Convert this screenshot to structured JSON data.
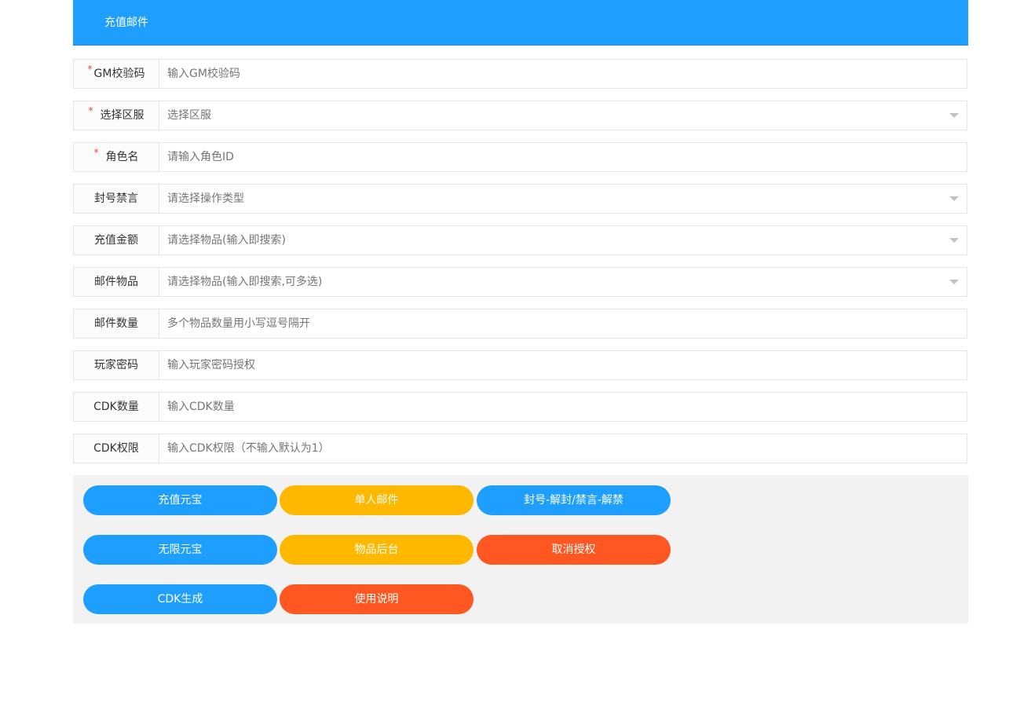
{
  "header": {
    "title": "充值邮件"
  },
  "form": {
    "gm_code": {
      "label": "GM校验码",
      "placeholder": "输入GM校验码"
    },
    "server": {
      "label": "选择区服",
      "placeholder": "选择区服"
    },
    "role_name": {
      "label": "角色名",
      "placeholder": "请输入角色ID"
    },
    "ban_mute": {
      "label": "封号禁言",
      "placeholder": "请选择操作类型"
    },
    "recharge_amount": {
      "label": "充值金额",
      "placeholder": "请选择物品(输入即搜索)"
    },
    "mail_items": {
      "label": "邮件物品",
      "placeholder": "请选择物品(输入即搜索,可多选)"
    },
    "mail_quantity": {
      "label": "邮件数量",
      "placeholder": "多个物品数量用小写逗号隔开"
    },
    "player_password": {
      "label": "玩家密码",
      "placeholder": "输入玩家密码授权"
    },
    "cdk_quantity": {
      "label": "CDK数量",
      "placeholder": "输入CDK数量"
    },
    "cdk_permission": {
      "label": "CDK权限",
      "placeholder": "输入CDK权限（不输入默认为1）"
    },
    "required_mark": "*"
  },
  "buttons": {
    "recharge_yuanbao": "充值元宝",
    "single_mail": "单人邮件",
    "ban_unban": "封号-解封/禁言-解禁",
    "unlimited_yuanbao": "无限元宝",
    "item_backend": "物品后台",
    "cancel_auth": "取消授权",
    "cdk_generate": "CDK生成",
    "usage_guide": "使用说明"
  },
  "colors": {
    "blue": "#1e9fff",
    "yellow": "#ffb800",
    "red": "#ff5722"
  }
}
